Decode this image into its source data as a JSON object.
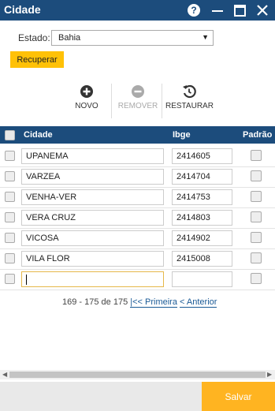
{
  "window": {
    "title": "Cidade"
  },
  "filter": {
    "estado_label": "Estado:",
    "estado_value": "Bahia",
    "recuperar_label": "Recuperar"
  },
  "toolbar": {
    "novo": "NOVO",
    "remover": "REMOVER",
    "restaurar": "RESTAURAR"
  },
  "grid": {
    "columns": {
      "cidade": "Cidade",
      "ibge": "Ibge",
      "padrao": "Padrão"
    },
    "rows": [
      {
        "cidade": "UPANEMA",
        "ibge": "2414605"
      },
      {
        "cidade": "VARZEA",
        "ibge": "2414704"
      },
      {
        "cidade": "VENHA-VER",
        "ibge": "2414753"
      },
      {
        "cidade": "VERA CRUZ",
        "ibge": "2414803"
      },
      {
        "cidade": "VICOSA",
        "ibge": "2414902"
      },
      {
        "cidade": "VILA FLOR",
        "ibge": "2415008"
      },
      {
        "cidade": "",
        "ibge": ""
      }
    ]
  },
  "pager": {
    "range": "169 - 175 de 175",
    "first": "|<< Primeira",
    "prev": "< Anterior"
  },
  "footer": {
    "salvar": "Salvar"
  },
  "colors": {
    "header": "#1c4c7c",
    "accent": "#ffc107",
    "save": "#ffb421"
  }
}
